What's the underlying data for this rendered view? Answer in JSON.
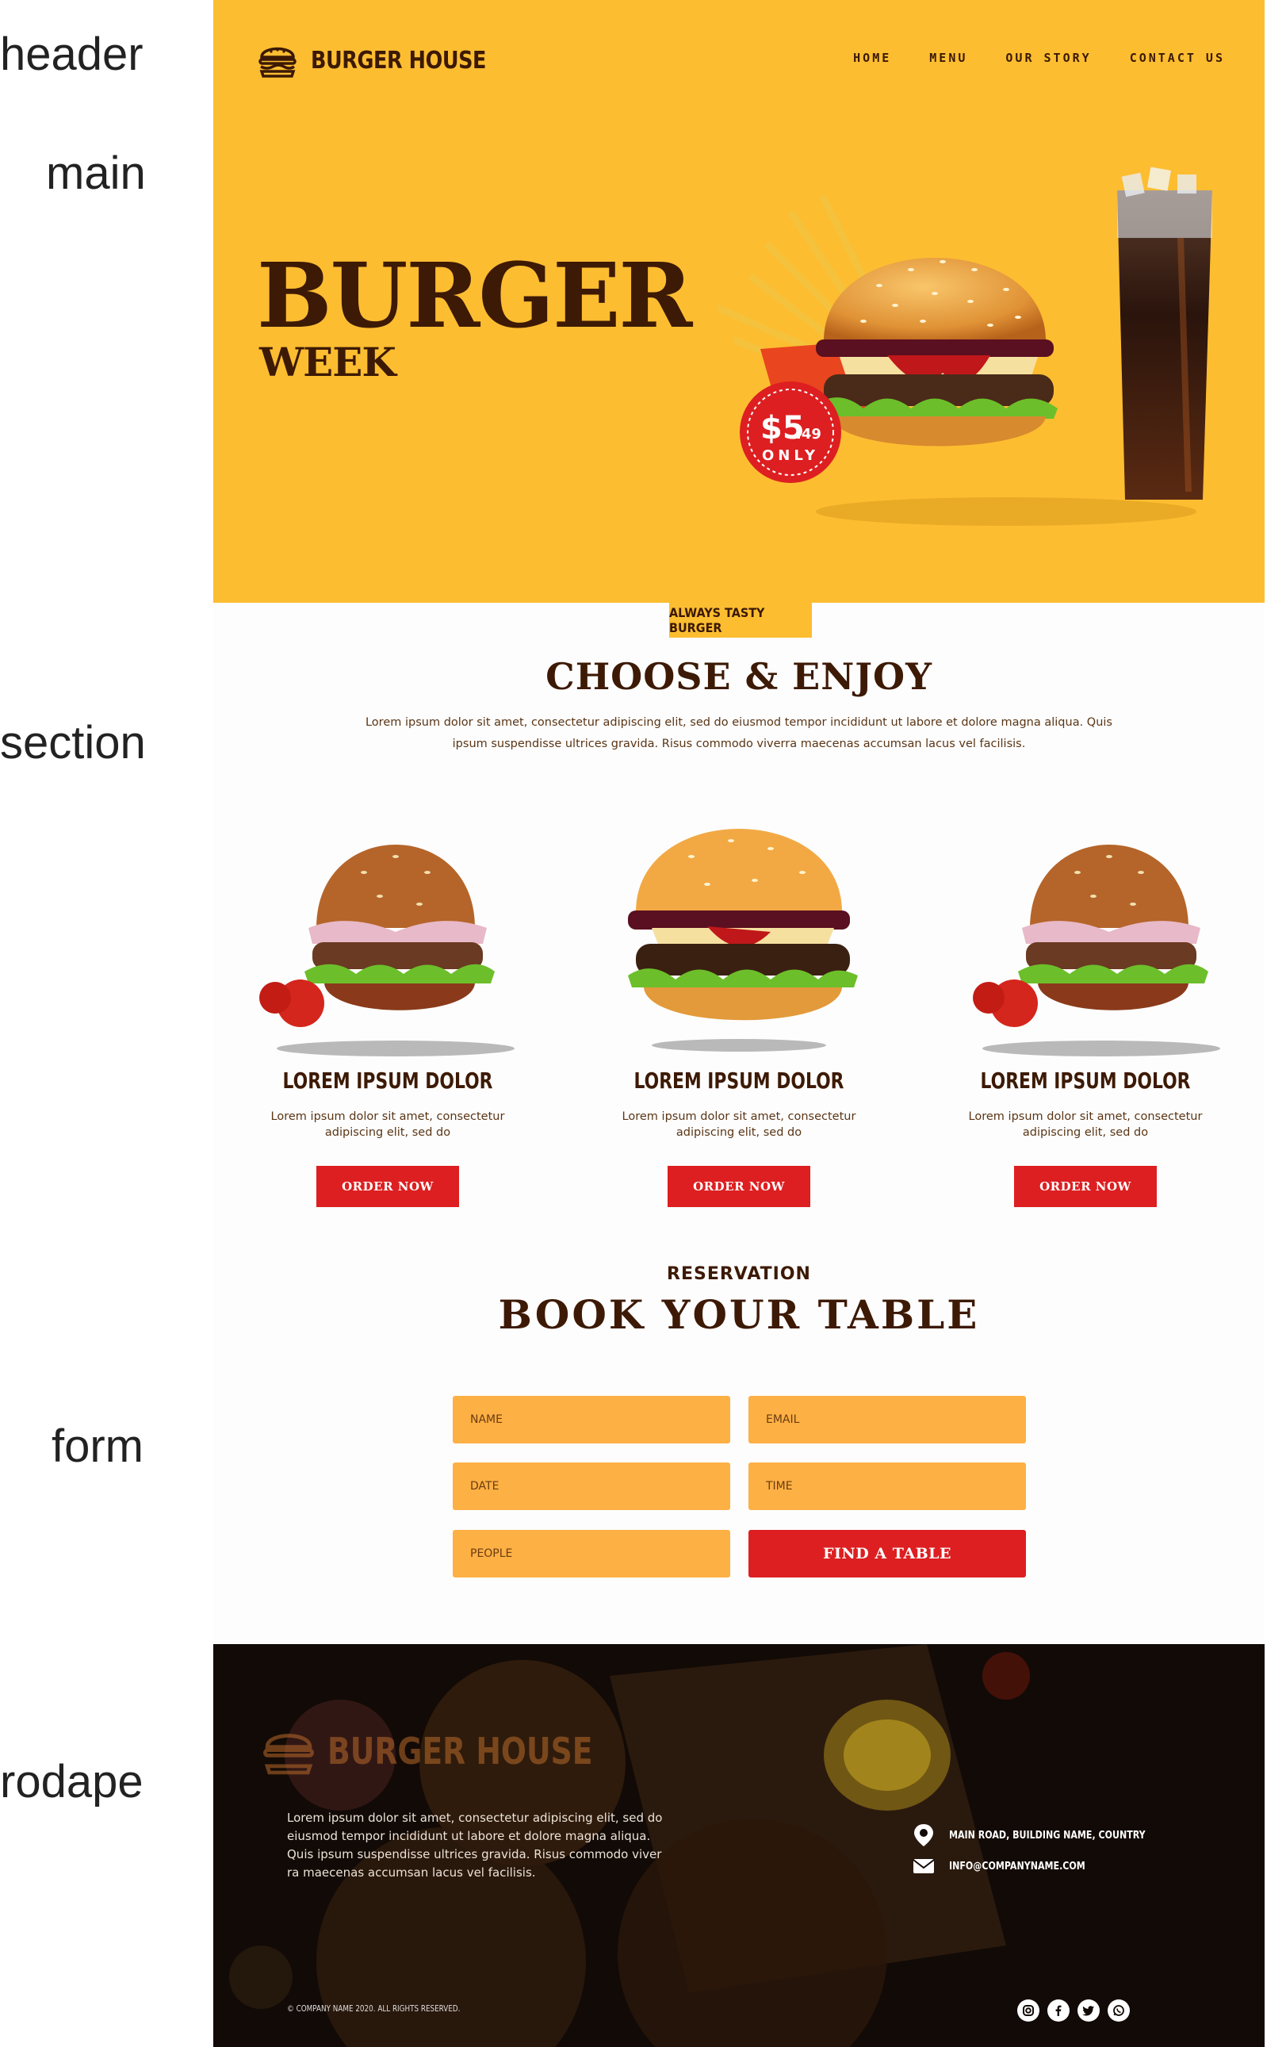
{
  "annotations": [
    "header",
    "main",
    "section",
    "form",
    "rodape"
  ],
  "brand": {
    "name": "BURGER HOUSE"
  },
  "nav": [
    "HOME",
    "MENU",
    "OUR STORY",
    "CONTACT US"
  ],
  "hero": {
    "title": "BURGER",
    "subtitle": "WEEK",
    "price_main": "$5",
    "price_cents": ".49",
    "price_note": "ONLY"
  },
  "section": {
    "tag": "ALWAYS TASTY BURGER",
    "title": "CHOOSE & ENJOY",
    "description": "Lorem ipsum dolor sit amet, consectetur adipiscing elit, sed do eiusmod tempor incididunt ut labore et dolore magna aliqua. Quis ipsum suspendisse ultrices gravida. Risus commodo viverra maecenas accumsan lacus vel facilisis.",
    "cards": [
      {
        "title": "LOREM IPSUM DOLOR",
        "description": "Lorem ipsum dolor sit amet, consectetur adipiscing elit, sed do",
        "button": "ORDER NOW"
      },
      {
        "title": "LOREM IPSUM DOLOR",
        "description": "Lorem ipsum dolor sit amet, consectetur adipiscing elit, sed do",
        "button": "ORDER NOW"
      },
      {
        "title": "LOREM IPSUM DOLOR",
        "description": "Lorem ipsum dolor sit amet, consectetur adipiscing elit, sed do",
        "button": "ORDER NOW"
      }
    ]
  },
  "reservation": {
    "label": "RESERVATION",
    "title": "BOOK YOUR TABLE",
    "fields": {
      "name": "NAME",
      "email": "EMAIL",
      "date": "DATE",
      "time": "TIME",
      "people": "PEOPLE"
    },
    "button": "FIND A TABLE"
  },
  "footer": {
    "logo_text": "BURGER HOUSE",
    "description": "Lorem ipsum dolor sit amet, consectetur adipiscing elit, sed do eiusmod tempor incididunt ut labore et dolore magna aliqua. Quis ipsum suspendisse ultrices gravida. Risus commodo viver ra maecenas accumsan lacus vel facilisis.",
    "address": "MAIN ROAD, BUILDING NAME, COUNTRY",
    "email": "INFO@COMPANYNAME.COM",
    "copyright": "© COMPANY NAME 2020. ALL RIGHTS RESERVED.",
    "social_icons": [
      "instagram-icon",
      "facebook-icon",
      "twitter-icon",
      "whatsapp-icon"
    ]
  },
  "colors": {
    "hero_yellow": "#fdbd31",
    "brown": "#3d1a05",
    "red": "#dd1f21",
    "field_orange": "#fdb044",
    "footer_dark": "#0e0805"
  }
}
